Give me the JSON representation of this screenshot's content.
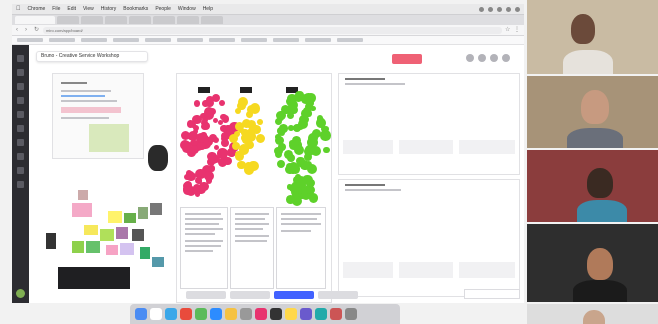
{
  "menubar": {
    "items": [
      "Chrome",
      "File",
      "Edit",
      "View",
      "History",
      "Bookmarks",
      "People",
      "Window",
      "Help"
    ]
  },
  "browser": {
    "address": "miro.com/app/board/"
  },
  "board": {
    "title": "Bruno - Creative Service Workshop"
  },
  "colors": {
    "accent_share": "#ef6175",
    "miro_blue": "#4262ff",
    "pink": "#e8336f",
    "yellow": "#f6d920",
    "green": "#5ed12a",
    "purple": "#a25be0",
    "teal": "#3aa5a8"
  },
  "icons": {
    "apple": "apple-icon",
    "back": "back-arrow-icon",
    "forward": "forward-arrow-icon",
    "reload": "reload-icon"
  },
  "video_participants": 5
}
